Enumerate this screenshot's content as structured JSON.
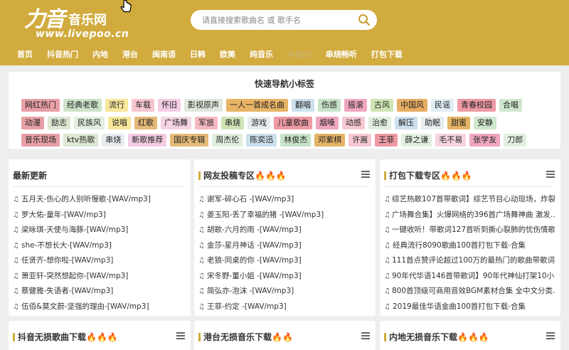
{
  "header": {
    "logo_cn": "力音",
    "logo_cn2": "音乐网",
    "logo_url": "www.livepoo.cn",
    "search_placeholder": "请直接搜索歌曲名 或 歌手名",
    "brand_color": "#d2ab3e"
  },
  "nav": [
    {
      "label": "首页"
    },
    {
      "label": "抖音热门"
    },
    {
      "label": "内地"
    },
    {
      "label": "港台"
    },
    {
      "label": "闽南语"
    },
    {
      "label": "日韩"
    },
    {
      "label": "欧美"
    },
    {
      "label": "纯音乐"
    },
    {
      "label": "车载DJ"
    },
    {
      "label": "串烧畅听"
    },
    {
      "label": "打包下载"
    }
  ],
  "quick_nav": {
    "title": "快速导航小标签",
    "rows": [
      [
        {
          "label": "网红热门",
          "color": "#e8a0a6"
        },
        {
          "label": "经典老歌",
          "color": "#cde3c8"
        },
        {
          "label": "流行",
          "color": "#f7e79a"
        },
        {
          "label": "车载",
          "color": "#f7c7cf"
        },
        {
          "label": "怀旧",
          "color": "#f4cde3"
        },
        {
          "label": "影视原声",
          "color": "#dfe8dc"
        },
        {
          "label": "一人一首成名曲",
          "color": "#e8b466"
        },
        {
          "label": "翻唱",
          "color": "#cde0ee"
        },
        {
          "label": "伤感",
          "color": "#c8e2c9"
        },
        {
          "label": "摇滚",
          "color": "#f0a7c0"
        },
        {
          "label": "古风",
          "color": "#cfe4b5"
        },
        {
          "label": "中国风",
          "color": "#e7ad63"
        },
        {
          "label": "民谣",
          "color": "#e0edf4"
        },
        {
          "label": "青春校园",
          "color": "#ef9aa4"
        },
        {
          "label": "合唱",
          "color": "#cfe7cf"
        }
      ],
      [
        {
          "label": "动漫",
          "color": "#e8a0a6"
        },
        {
          "label": "励志",
          "color": "#dde7d3"
        },
        {
          "label": "民族风",
          "color": "#e2efe0"
        },
        {
          "label": "说唱",
          "color": "#f7e79a"
        },
        {
          "label": "红歌",
          "color": "#e5ba78"
        },
        {
          "label": "广场舞",
          "color": "#f4d3e4"
        },
        {
          "label": "军旅",
          "color": "#f5b9c2"
        },
        {
          "label": "串烧",
          "color": "#cfe4b5"
        },
        {
          "label": "游戏",
          "color": "#e7ecef"
        },
        {
          "label": "儿童歌曲",
          "color": "#ef9aa4"
        },
        {
          "label": "烟嗓",
          "color": "#f0a7c0"
        },
        {
          "label": "动感",
          "color": "#f6c9d2"
        },
        {
          "label": "治愈",
          "color": "#e2efe0"
        },
        {
          "label": "解压",
          "color": "#cde0ee"
        },
        {
          "label": "助眠",
          "color": "#e7ecef"
        },
        {
          "label": "甜蜜",
          "color": "#e4b466"
        },
        {
          "label": "安静",
          "color": "#cfe7cf"
        }
      ],
      [
        {
          "label": "音乐现场",
          "color": "#e8a0a6"
        },
        {
          "label": "ktv热歌",
          "color": "#dde7d3"
        },
        {
          "label": "串烧",
          "color": "#e7ecef"
        },
        {
          "label": "新歌推荐",
          "color": "#f4cde3"
        },
        {
          "label": "国庆专辑",
          "color": "#e5ba78"
        },
        {
          "label": "周杰伦",
          "color": "#e2efe0"
        },
        {
          "label": "陈奕迅",
          "color": "#cde0ee"
        },
        {
          "label": "林俊杰",
          "color": "#c8e2c9"
        },
        {
          "label": "邓紫棋",
          "color": "#e4b466"
        },
        {
          "label": "许嵩",
          "color": "#f6c9d2"
        },
        {
          "label": "王菲",
          "color": "#ef9aa4"
        },
        {
          "label": "薛之谦",
          "color": "#e2efe0"
        },
        {
          "label": "毛不易",
          "color": "#f6d4de"
        },
        {
          "label": "张学友",
          "color": "#f0a7c0"
        },
        {
          "label": "刀郎",
          "color": "#e2efe0"
        }
      ]
    ]
  },
  "panels": [
    {
      "title": "最新更新",
      "songs": [
        "五月天-伤心的人别听慢歌-[WAV/mp3]",
        "罗大佑-童年-[WAV/mp3]",
        "梁咏琪-天使与海豚-[WAV/mp3]",
        "she-不想长大-[WAV/mp3]",
        "任贤齐-想你啦-[WAV/mp3]",
        "萧亚轩-突然想起你-[WAV/mp3]",
        "蔡健雅-失语者-[WAV/mp3]",
        "伍佰&莫文蔚-坚强的理由-[WAV/mp3]"
      ]
    },
    {
      "title": "网友投稿专区🔥🔥🔥",
      "songs": [
        "谢军-碎心石 -[WAV/mp3]",
        "姜玉阳-丢了幸福的猪 -[WAV/mp3]",
        "胡歌-六月的雨 -[WAV/mp3]",
        "金莎-星月神话 -[WAV/mp3]",
        "老狼-同桌的你 -[WAV/mp3]",
        "宋冬野-董小姐 -[WAV/mp3]",
        "简弘亦-泡沫 -[WAV/mp3]",
        "王菲-约定 -[WAV/mp3]"
      ]
    },
    {
      "title": "打包下载专区🔥🔥🔥",
      "songs": [
        "综艺热歌107首带歌词】综艺节目心动现场，炸裂...",
        "广场舞合集】火爆网络的396首广场舞神曲 激发...",
        "一键收听！带歌词127首听到撕心裂肺的忧伤情歌...",
        "经典流行8090歌曲100首打包下载-合集",
        "111首点赞评论超过100万的最热门的歌曲带歌词...",
        "90年代华语146首带歌词】90年代神仙打架10小...",
        "800首顶级可商用音效BGM素材合集 全中文分类...",
        "2019最佳华语金曲100首打包下载-合集"
      ]
    },
    {
      "title": "抖音无损歌曲下载🔥🔥🔥"
    },
    {
      "title": "港台无损音乐下载🔥🔥"
    },
    {
      "title": "内地无损音乐下载🔥🔥🔥"
    }
  ]
}
